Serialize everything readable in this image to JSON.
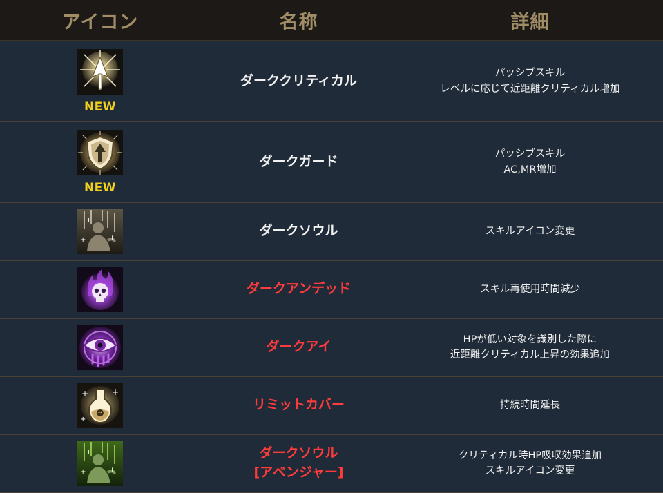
{
  "header": {
    "icon_col": "アイコン",
    "name_col": "名称",
    "detail_col": "詳細"
  },
  "colors": {
    "header_text": "#a08d66",
    "row_bg": "#1f2b38",
    "new_badge": "#f2d21a",
    "highlight_name": "#ff3b3b"
  },
  "rows": [
    {
      "icon": "dark-critical-icon",
      "badge": "NEW",
      "name": "ダーククリティカル",
      "name_color": "white",
      "detail": [
        "パッシブスキル",
        "レベルに応じて近距離クリティカル増加"
      ]
    },
    {
      "icon": "dark-guard-icon",
      "badge": "NEW",
      "name": "ダークガード",
      "name_color": "white",
      "detail": [
        "パッシブスキル",
        "AC,MR増加"
      ]
    },
    {
      "icon": "dark-soul-icon",
      "name": "ダークソウル",
      "name_color": "white",
      "detail": [
        "スキルアイコン変更"
      ]
    },
    {
      "icon": "dark-undead-icon",
      "name": "ダークアンデッド",
      "name_color": "red",
      "detail": [
        "スキル再使用時間減少"
      ]
    },
    {
      "icon": "dark-eye-icon",
      "name": "ダークアイ",
      "name_color": "red",
      "detail": [
        "HPが低い対象を識別した際に",
        "近距離クリティカル上昇の効果追加"
      ]
    },
    {
      "icon": "limit-cover-icon",
      "name": "リミットカバー",
      "name_color": "red",
      "detail": [
        "持続時間延長"
      ]
    },
    {
      "icon": "dark-soul-avenger-icon",
      "name": [
        "ダークソウル",
        "[アベンジャー]"
      ],
      "name_color": "red",
      "detail": [
        "クリティカル時HP吸収効果追加",
        "スキルアイコン変更"
      ]
    }
  ]
}
